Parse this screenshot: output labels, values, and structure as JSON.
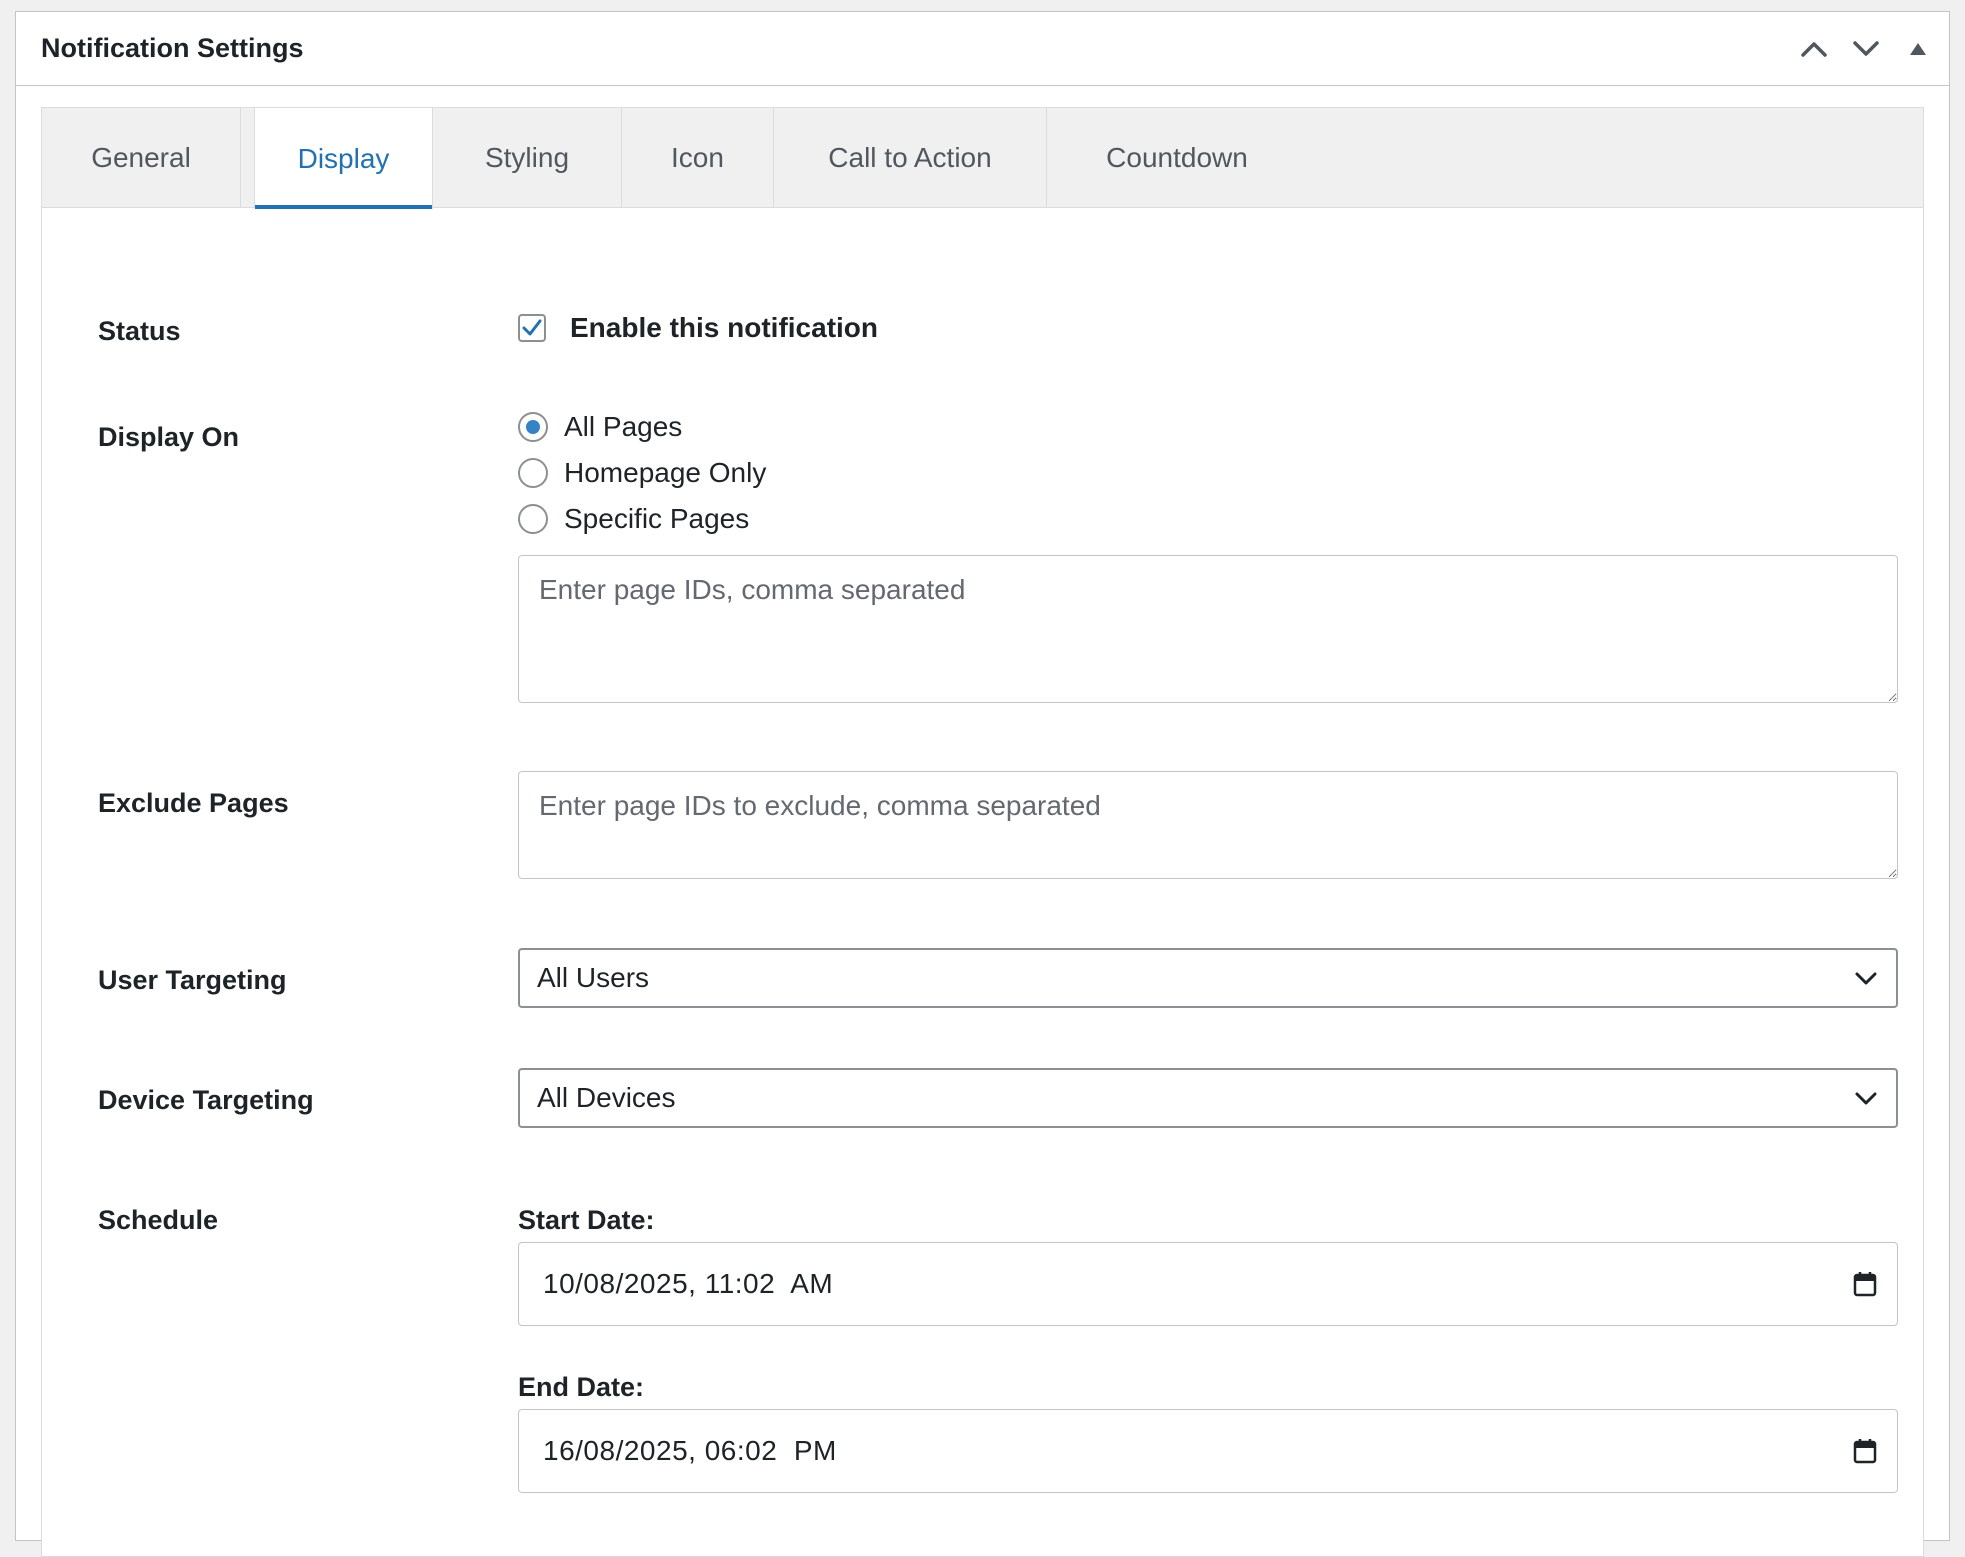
{
  "box": {
    "title": "Notification Settings",
    "actions": [
      {
        "icon": "chevron-up-icon"
      },
      {
        "icon": "chevron-down-icon"
      },
      {
        "icon": "triangle-up-icon"
      }
    ]
  },
  "tabs": [
    {
      "label": "General",
      "active": false
    },
    {
      "label": "Display",
      "active": true
    },
    {
      "label": "Styling",
      "active": false
    },
    {
      "label": "Icon",
      "active": false
    },
    {
      "label": "Call to Action",
      "active": false
    },
    {
      "label": "Countdown",
      "active": false
    }
  ],
  "form": {
    "status": {
      "label": "Status",
      "checkbox_label": "Enable this notification",
      "checked": true
    },
    "display_on": {
      "label": "Display On",
      "options": [
        "All Pages",
        "Homepage Only",
        "Specific Pages"
      ],
      "selected": "All Pages",
      "pages_placeholder": "Enter page IDs, comma separated",
      "pages_value": ""
    },
    "exclude_pages": {
      "label": "Exclude Pages",
      "placeholder": "Enter page IDs to exclude, comma separated",
      "value": ""
    },
    "user_targeting": {
      "label": "User Targeting",
      "value": "All Users"
    },
    "device_targeting": {
      "label": "Device Targeting",
      "value": "All Devices"
    },
    "schedule": {
      "label": "Schedule",
      "start_label": "Start Date:",
      "start_value": "10/08/2025, 11:02  AM",
      "end_label": "End Date:",
      "end_value": "16/08/2025, 06:02  PM"
    }
  },
  "colors": {
    "accent": "#2271b1",
    "radio_checked": "#3582c4",
    "border": "#c3c4c7"
  }
}
